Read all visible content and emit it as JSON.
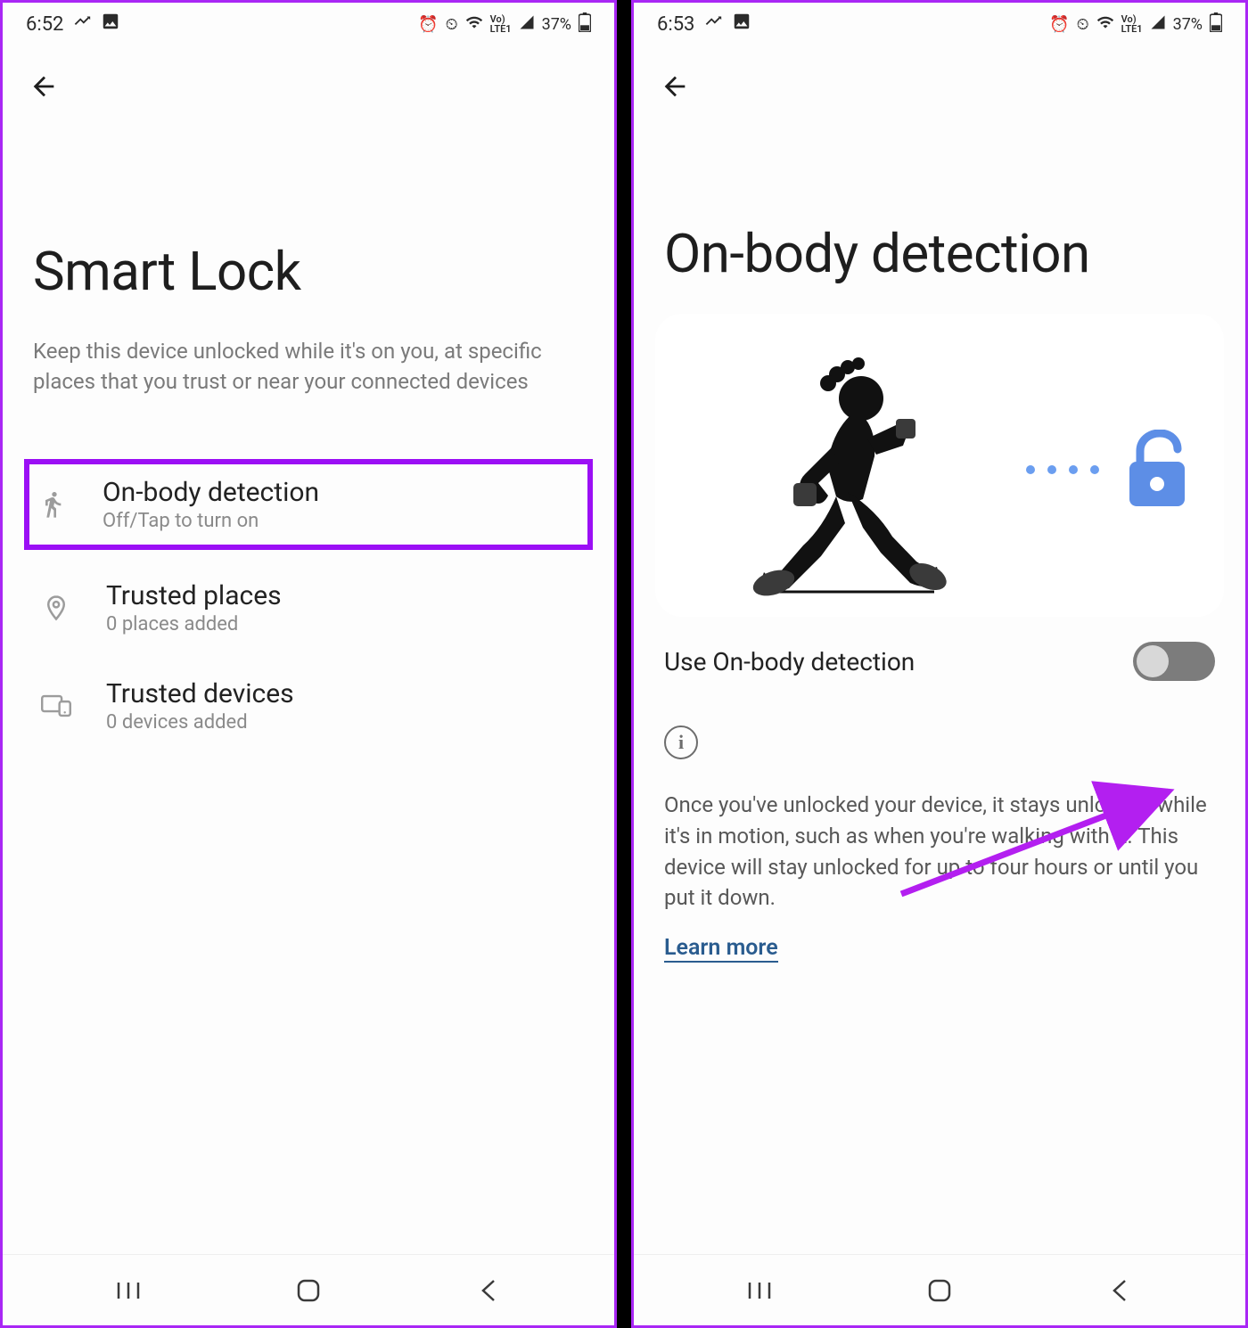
{
  "left": {
    "status": {
      "time": "6:52",
      "battery": "37%"
    },
    "title": "Smart Lock",
    "desc": "Keep this device unlocked while it's on you, at specific places that you trust or near your connected devices",
    "items": [
      {
        "title": "On-body detection",
        "sub": "Off/Tap to turn on"
      },
      {
        "title": "Trusted places",
        "sub": "0 places added"
      },
      {
        "title": "Trusted devices",
        "sub": "0 devices added"
      }
    ]
  },
  "right": {
    "status": {
      "time": "6:53",
      "battery": "37%"
    },
    "title": "On-body detection",
    "toggle_label": "Use On-body detection",
    "info_text": "Once you've unlocked your device, it stays unlocked while it's in motion, such as when you're walking with it. This device will stay unlocked for up to four hours or until you put it down.",
    "learn_more": "Learn more"
  }
}
